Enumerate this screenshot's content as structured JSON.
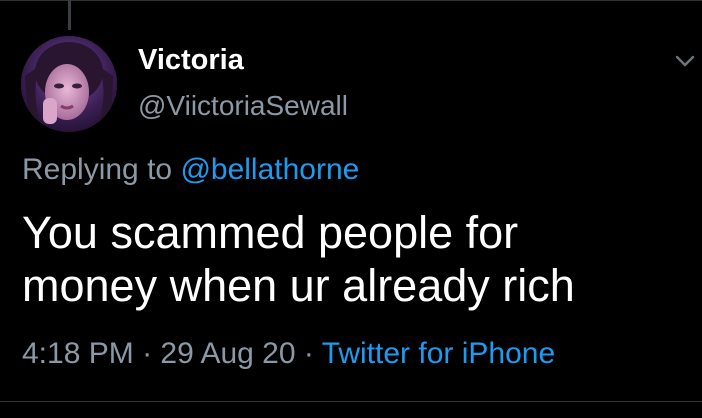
{
  "tweet": {
    "author": {
      "display_name": "Victoria",
      "handle": "@ViictoriaSewall",
      "avatar": "profile-photo"
    },
    "reply": {
      "prefix": "Replying to",
      "mention": "@bellathorne"
    },
    "text_line1": "You scammed people for",
    "text_line2": "money when ur already rich",
    "meta": {
      "time": "4:18 PM",
      "separator": "·",
      "date": "29 Aug 20",
      "source": "Twitter for iPhone"
    },
    "menu_icon": "chevron-down-icon"
  },
  "colors": {
    "background": "#000000",
    "primary_text": "#ffffff",
    "secondary_text": "#8b98a5",
    "accent": "#1d9bf0"
  }
}
